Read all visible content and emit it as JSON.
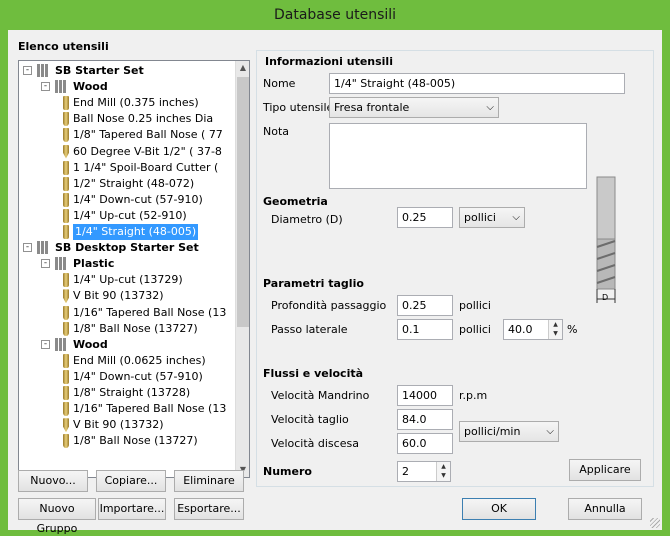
{
  "window": {
    "title": "Database utensili"
  },
  "tree": {
    "label": "Elenco utensili",
    "rows": [
      {
        "label": "SB Starter Set",
        "kind": "set",
        "expander": "-"
      },
      {
        "label": "Wood",
        "kind": "group",
        "expander": "-"
      },
      {
        "label": "End Mill (0.375 inches)",
        "kind": "tool",
        "icon": "end-mill"
      },
      {
        "label": "Ball Nose 0.25 inches Dia",
        "kind": "tool",
        "icon": "ball"
      },
      {
        "label": "1/8\" Tapered Ball Nose ( 77",
        "kind": "tool",
        "icon": "ball"
      },
      {
        "label": "60 Degree V-Bit 1/2\" ( 37-8",
        "kind": "tool",
        "icon": "v"
      },
      {
        "label": "1 1/4\" Spoil-Board Cutter (",
        "kind": "tool",
        "icon": "end-mill"
      },
      {
        "label": "1/2\" Straight  (48-072)",
        "kind": "tool",
        "icon": "end-mill"
      },
      {
        "label": "1/4\"  Down-cut (57-910)",
        "kind": "tool",
        "icon": "end-mill"
      },
      {
        "label": "1/4\" Up-cut (52-910)",
        "kind": "tool",
        "icon": "end-mill"
      },
      {
        "label": "1/4\" Straight  (48-005)",
        "kind": "tool",
        "icon": "end-mill",
        "selected": true
      },
      {
        "label": "SB Desktop Starter Set",
        "kind": "set",
        "expander": "-"
      },
      {
        "label": "Plastic",
        "kind": "group",
        "expander": "-"
      },
      {
        "label": "1/4\" Up-cut (13729)",
        "kind": "tool",
        "icon": "end-mill"
      },
      {
        "label": "V Bit 90 (13732)",
        "kind": "tool",
        "icon": "v"
      },
      {
        "label": "1/16\" Tapered Ball Nose (13",
        "kind": "tool",
        "icon": "ball"
      },
      {
        "label": "1/8\" Ball Nose (13727)",
        "kind": "tool",
        "icon": "ball"
      },
      {
        "label": "Wood",
        "kind": "group",
        "expander": "-"
      },
      {
        "label": "End Mill (0.0625 inches)",
        "kind": "tool",
        "icon": "end-mill"
      },
      {
        "label": "1/4\"  Down-cut (57-910)",
        "kind": "tool",
        "icon": "end-mill"
      },
      {
        "label": "1/8\" Straight (13728)",
        "kind": "tool",
        "icon": "end-mill"
      },
      {
        "label": "1/16\" Tapered Ball Nose (13",
        "kind": "tool",
        "icon": "ball"
      },
      {
        "label": "V Bit 90 (13732)",
        "kind": "tool",
        "icon": "v"
      },
      {
        "label": "1/8\" Ball Nose (13727)",
        "kind": "tool",
        "icon": "ball"
      }
    ]
  },
  "buttons": {
    "new": "Nuovo...",
    "copy": "Copiare...",
    "delete": "Eliminare",
    "new_group": "Nuovo Gruppo",
    "import": "Importare...",
    "export": "Esportare...",
    "apply": "Applicare",
    "ok": "OK",
    "cancel": "Annulla"
  },
  "info": {
    "title": "Informazioni utensili",
    "name_label": "Nome",
    "name_value": "1/4\" Straight  (48-005)",
    "type_label": "Tipo utensile",
    "type_value": "Fresa frontale",
    "note_label": "Nota",
    "note_value": ""
  },
  "geometry": {
    "title": "Geometria",
    "diameter_label": "Diametro (D)",
    "diameter_value": "0.25",
    "unit_value": "pollici",
    "diagram_label": "D"
  },
  "cutting": {
    "title": "Parametri taglio",
    "depth_label": "Profondità passaggio",
    "depth_value": "0.25",
    "depth_unit": "pollici",
    "stepover_label": "Passo laterale",
    "stepover_value": "0.1",
    "stepover_unit": "pollici",
    "stepover_pct": "40.0",
    "pct_sign": "%"
  },
  "feeds": {
    "title": "Flussi e velocità",
    "spindle_label": "Velocità Mandrino",
    "spindle_value": "14000",
    "spindle_unit": "r.p.m",
    "feed_label": "Velocità taglio",
    "feed_value": "84.0",
    "plunge_label": "Velocità discesa",
    "plunge_value": "60.0",
    "rate_unit": "pollici/min"
  },
  "number": {
    "label": "Numero",
    "value": "2"
  },
  "icons": {
    "up": "▲",
    "down": "▼",
    "dropdown": "⌵"
  }
}
